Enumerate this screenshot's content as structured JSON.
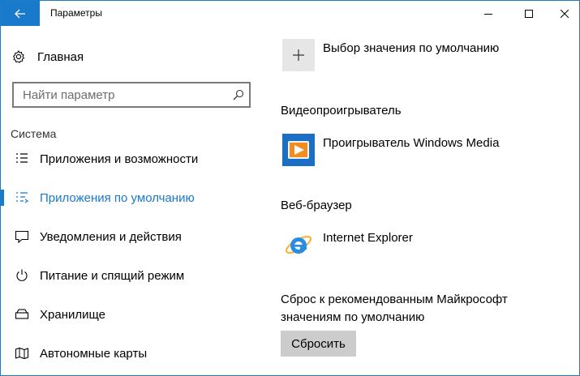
{
  "window": {
    "title": "Параметры",
    "accent": "#1979ca"
  },
  "sidebar": {
    "home_label": "Главная",
    "search_placeholder": "Найти параметр",
    "section_title": "Система",
    "items": [
      {
        "label": "Приложения и возможности",
        "icon": "apps-features-icon"
      },
      {
        "label": "Приложения по умолчанию",
        "icon": "default-apps-icon",
        "active": true
      },
      {
        "label": "Уведомления и действия",
        "icon": "notifications-icon"
      },
      {
        "label": "Питание и спящий режим",
        "icon": "power-icon"
      },
      {
        "label": "Хранилище",
        "icon": "storage-icon"
      },
      {
        "label": "Автономные карты",
        "icon": "offline-maps-icon"
      }
    ]
  },
  "main": {
    "choose_default_label": "Выбор значения по умолчанию",
    "video_section": "Видеопроигрыватель",
    "video_app": "Проигрыватель Windows Media",
    "browser_section": "Веб-браузер",
    "browser_app": "Internet Explorer",
    "reset_text": "Сброс к рекомендованным Майкрософт значениям по умолчанию",
    "reset_button": "Сбросить"
  }
}
